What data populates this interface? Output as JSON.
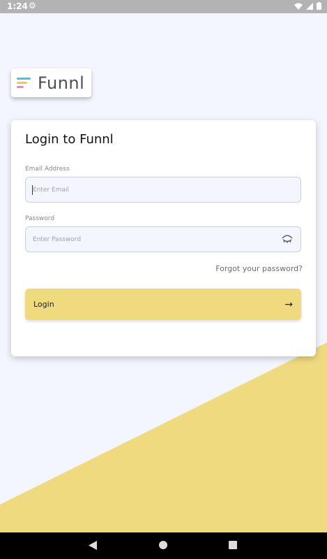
{
  "status": {
    "time": "1:24"
  },
  "logo": {
    "text": "Funnl"
  },
  "card": {
    "title": "Login to Funnl",
    "email_label": "Email Address",
    "email_placeholder": "Enter Email",
    "email_value": "",
    "password_label": "Password",
    "password_placeholder": "Enter Password",
    "password_value": "",
    "forgot": "Forgot your password?",
    "login_label": "Login",
    "login_arrow": "→"
  },
  "colors": {
    "accent_yellow": "#f0da80",
    "background": "#f3f6fe",
    "logo_cyan": "#4ec3e0",
    "logo_yellow": "#f2c94c",
    "logo_pink": "#e58ab0"
  },
  "icons": {
    "status": [
      "gear-icon",
      "wifi-icon",
      "signal-icon",
      "battery-icon"
    ],
    "password": "eye-closed-icon",
    "nav": [
      "back-icon",
      "home-icon",
      "recents-icon"
    ]
  }
}
